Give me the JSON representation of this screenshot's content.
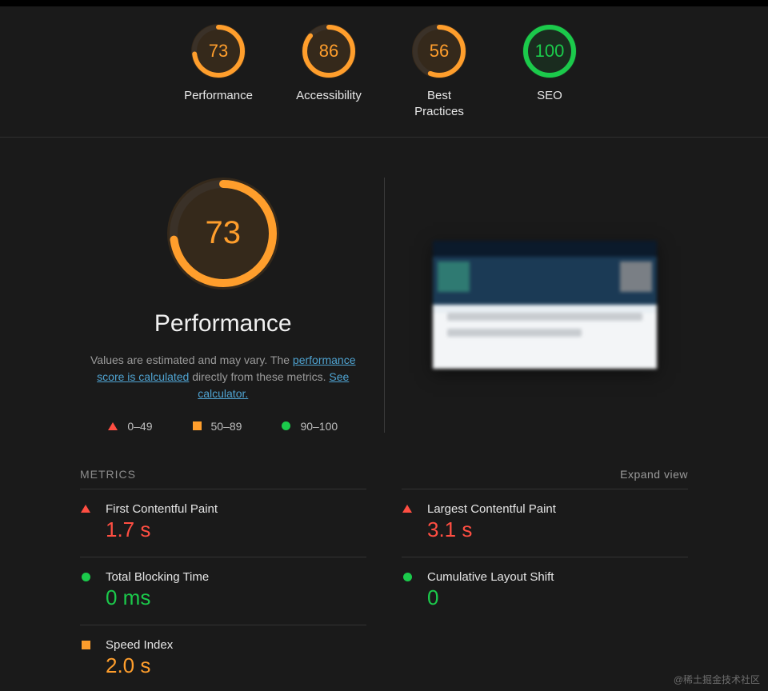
{
  "header_gauges": [
    {
      "label": "Performance",
      "score": 73,
      "status": "orange"
    },
    {
      "label": "Accessibility",
      "score": 86,
      "status": "orange"
    },
    {
      "label": "Best Practices",
      "score": 56,
      "status": "orange"
    },
    {
      "label": "SEO",
      "score": 100,
      "status": "green"
    }
  ],
  "hero": {
    "score": 73,
    "status": "orange",
    "title": "Performance",
    "desc_prefix": "Values are estimated and may vary. The ",
    "link1": "performance score is calculated",
    "desc_mid": " directly from these metrics. ",
    "link2": "See calculator."
  },
  "legend": [
    {
      "shape": "tri-red",
      "text": "0–49"
    },
    {
      "shape": "sq-orange",
      "text": "50–89"
    },
    {
      "shape": "dot-green",
      "text": "90–100"
    }
  ],
  "metrics_title": "METRICS",
  "expand_label": "Expand view",
  "metrics": [
    {
      "name": "First Contentful Paint",
      "value": "1.7 s",
      "status": "red"
    },
    {
      "name": "Largest Contentful Paint",
      "value": "3.1 s",
      "status": "red"
    },
    {
      "name": "Total Blocking Time",
      "value": "0 ms",
      "status": "green"
    },
    {
      "name": "Cumulative Layout Shift",
      "value": "0",
      "status": "green"
    },
    {
      "name": "Speed Index",
      "value": "2.0 s",
      "status": "orange"
    }
  ],
  "watermark": "@稀土掘金技术社区",
  "colors": {
    "orange": "#ff9e2c",
    "green": "#1bca4b",
    "red": "#ff4e42"
  }
}
